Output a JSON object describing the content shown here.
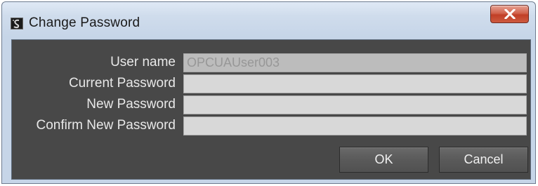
{
  "window": {
    "title": "Change Password",
    "close_label": "X"
  },
  "form": {
    "user_name": {
      "label": "User name",
      "value": "OPCUAUser003"
    },
    "current_password": {
      "label": "Current Password",
      "value": ""
    },
    "new_password": {
      "label": "New Password",
      "value": ""
    },
    "confirm_new_password": {
      "label": "Confirm New Password",
      "value": ""
    }
  },
  "buttons": {
    "ok_label": "OK",
    "cancel_label": "Cancel"
  },
  "colors": {
    "panel_background": "#484848",
    "label_text": "#e8e8e8",
    "close_button": "#c13f27"
  },
  "icons": {
    "app": "app-icon",
    "close": "close-icon"
  }
}
